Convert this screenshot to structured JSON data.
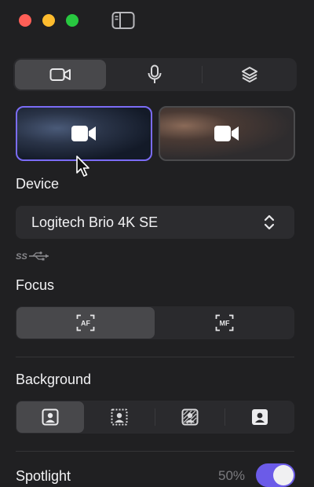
{
  "window": {
    "controls": [
      "close",
      "minimize",
      "zoom"
    ],
    "toolbar_icon": "sidebar-toggle-icon"
  },
  "top_tabs": [
    {
      "icon": "video-camera-icon",
      "active": true
    },
    {
      "icon": "microphone-icon",
      "active": false
    },
    {
      "icon": "layers-icon",
      "active": false
    }
  ],
  "camera_tiles": [
    {
      "icon": "video-camera-icon",
      "selected": true
    },
    {
      "icon": "video-camera-icon",
      "selected": false
    }
  ],
  "device": {
    "label": "Device",
    "selected": "Logitech Brio 4K SE",
    "connection_icon": "usb-superspeed-icon"
  },
  "focus": {
    "label": "Focus",
    "options": [
      {
        "text": "AF",
        "active": true
      },
      {
        "text": "MF",
        "active": false
      }
    ]
  },
  "background": {
    "label": "Background",
    "options": [
      {
        "icon": "background-none-icon",
        "active": true
      },
      {
        "icon": "background-blur-icon",
        "active": false
      },
      {
        "icon": "background-replace-icon",
        "active": false
      },
      {
        "icon": "background-remove-icon",
        "active": false
      }
    ]
  },
  "spotlight": {
    "label": "Spotlight",
    "value": "50%",
    "enabled": true
  },
  "colors": {
    "accent": "#7b6cf6",
    "toggle_on": "#6b5be8",
    "background": "#202022",
    "control_bg": "#2a2a2d",
    "control_active": "#48484b"
  }
}
